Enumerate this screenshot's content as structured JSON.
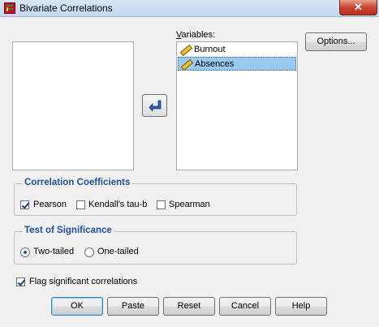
{
  "window": {
    "title": "Bivariate Correlations",
    "close_label": "✕"
  },
  "variables": {
    "label": "Variables:",
    "items": [
      {
        "name": "Burnout",
        "selected": false
      },
      {
        "name": "Absences",
        "selected": true
      }
    ]
  },
  "options_button": "Options...",
  "correlation_coefficients": {
    "title": "Correlation Coefficients",
    "pearson": {
      "label": "Pearson",
      "checked": true
    },
    "kendall": {
      "label": "Kendall's tau-b",
      "checked": false
    },
    "spearman": {
      "label": "Spearman",
      "checked": false
    }
  },
  "test_of_significance": {
    "title": "Test of Significance",
    "two_tailed": {
      "label": "Two-tailed",
      "selected": true
    },
    "one_tailed": {
      "label": "One-tailed",
      "selected": false
    }
  },
  "flag_significant": {
    "label": "Flag significant correlations",
    "checked": true
  },
  "buttons": {
    "ok": "OK",
    "paste": "Paste",
    "reset": "Reset",
    "cancel": "Cancel",
    "help": "Help"
  },
  "colors": {
    "group_title": "#1f4fa0",
    "selection": "#99c9ef",
    "close_button": "#c84631"
  },
  "icons": {
    "app": "spss-grid-icon",
    "variable": "scale-ruler-icon",
    "move": "arrow-left-icon"
  }
}
